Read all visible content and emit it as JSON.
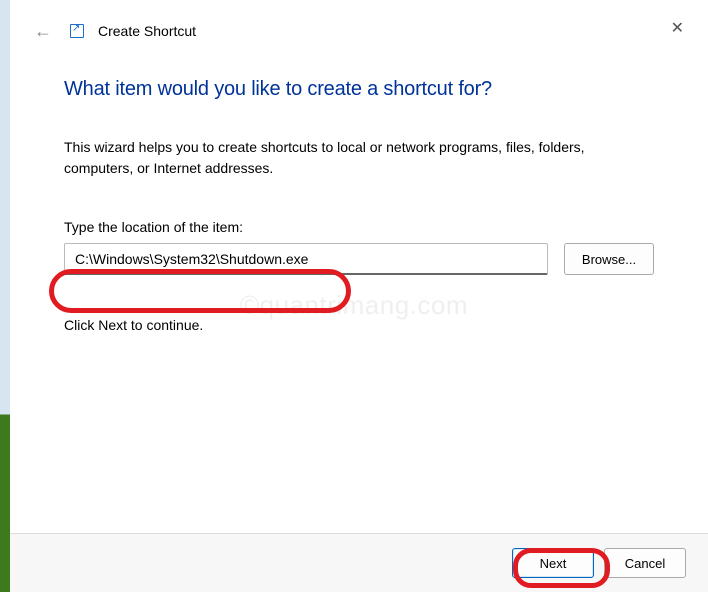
{
  "header": {
    "title": "Create Shortcut"
  },
  "content": {
    "heading": "What item would you like to create a shortcut for?",
    "description_line": "This wizard helps you to create shortcuts to local or network programs, files, folders, computers, or Internet addresses.",
    "location_label": "Type the location of the item:",
    "location_value": "C:\\Windows\\System32\\Shutdown.exe",
    "browse_label": "Browse...",
    "continue_text": "Click Next to continue."
  },
  "footer": {
    "next_label": "Next",
    "cancel_label": "Cancel"
  },
  "watermark": "©quantrimang.com"
}
